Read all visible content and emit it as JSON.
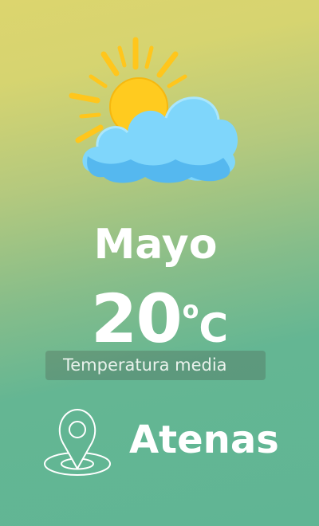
{
  "weather": {
    "icon": "partly-sunny-icon",
    "month": "Mayo",
    "temperature": {
      "value": "20",
      "degree_symbol": "o",
      "unit": "C"
    },
    "caption": "Temperatura media",
    "city": "Atenas",
    "location_icon": "location-pin-icon"
  },
  "colors": {
    "background_top": "#dcd56e",
    "background_bottom": "#60b594",
    "sun": "#ffcb1f",
    "cloud": "#7fd6fb",
    "text": "#ffffff"
  }
}
